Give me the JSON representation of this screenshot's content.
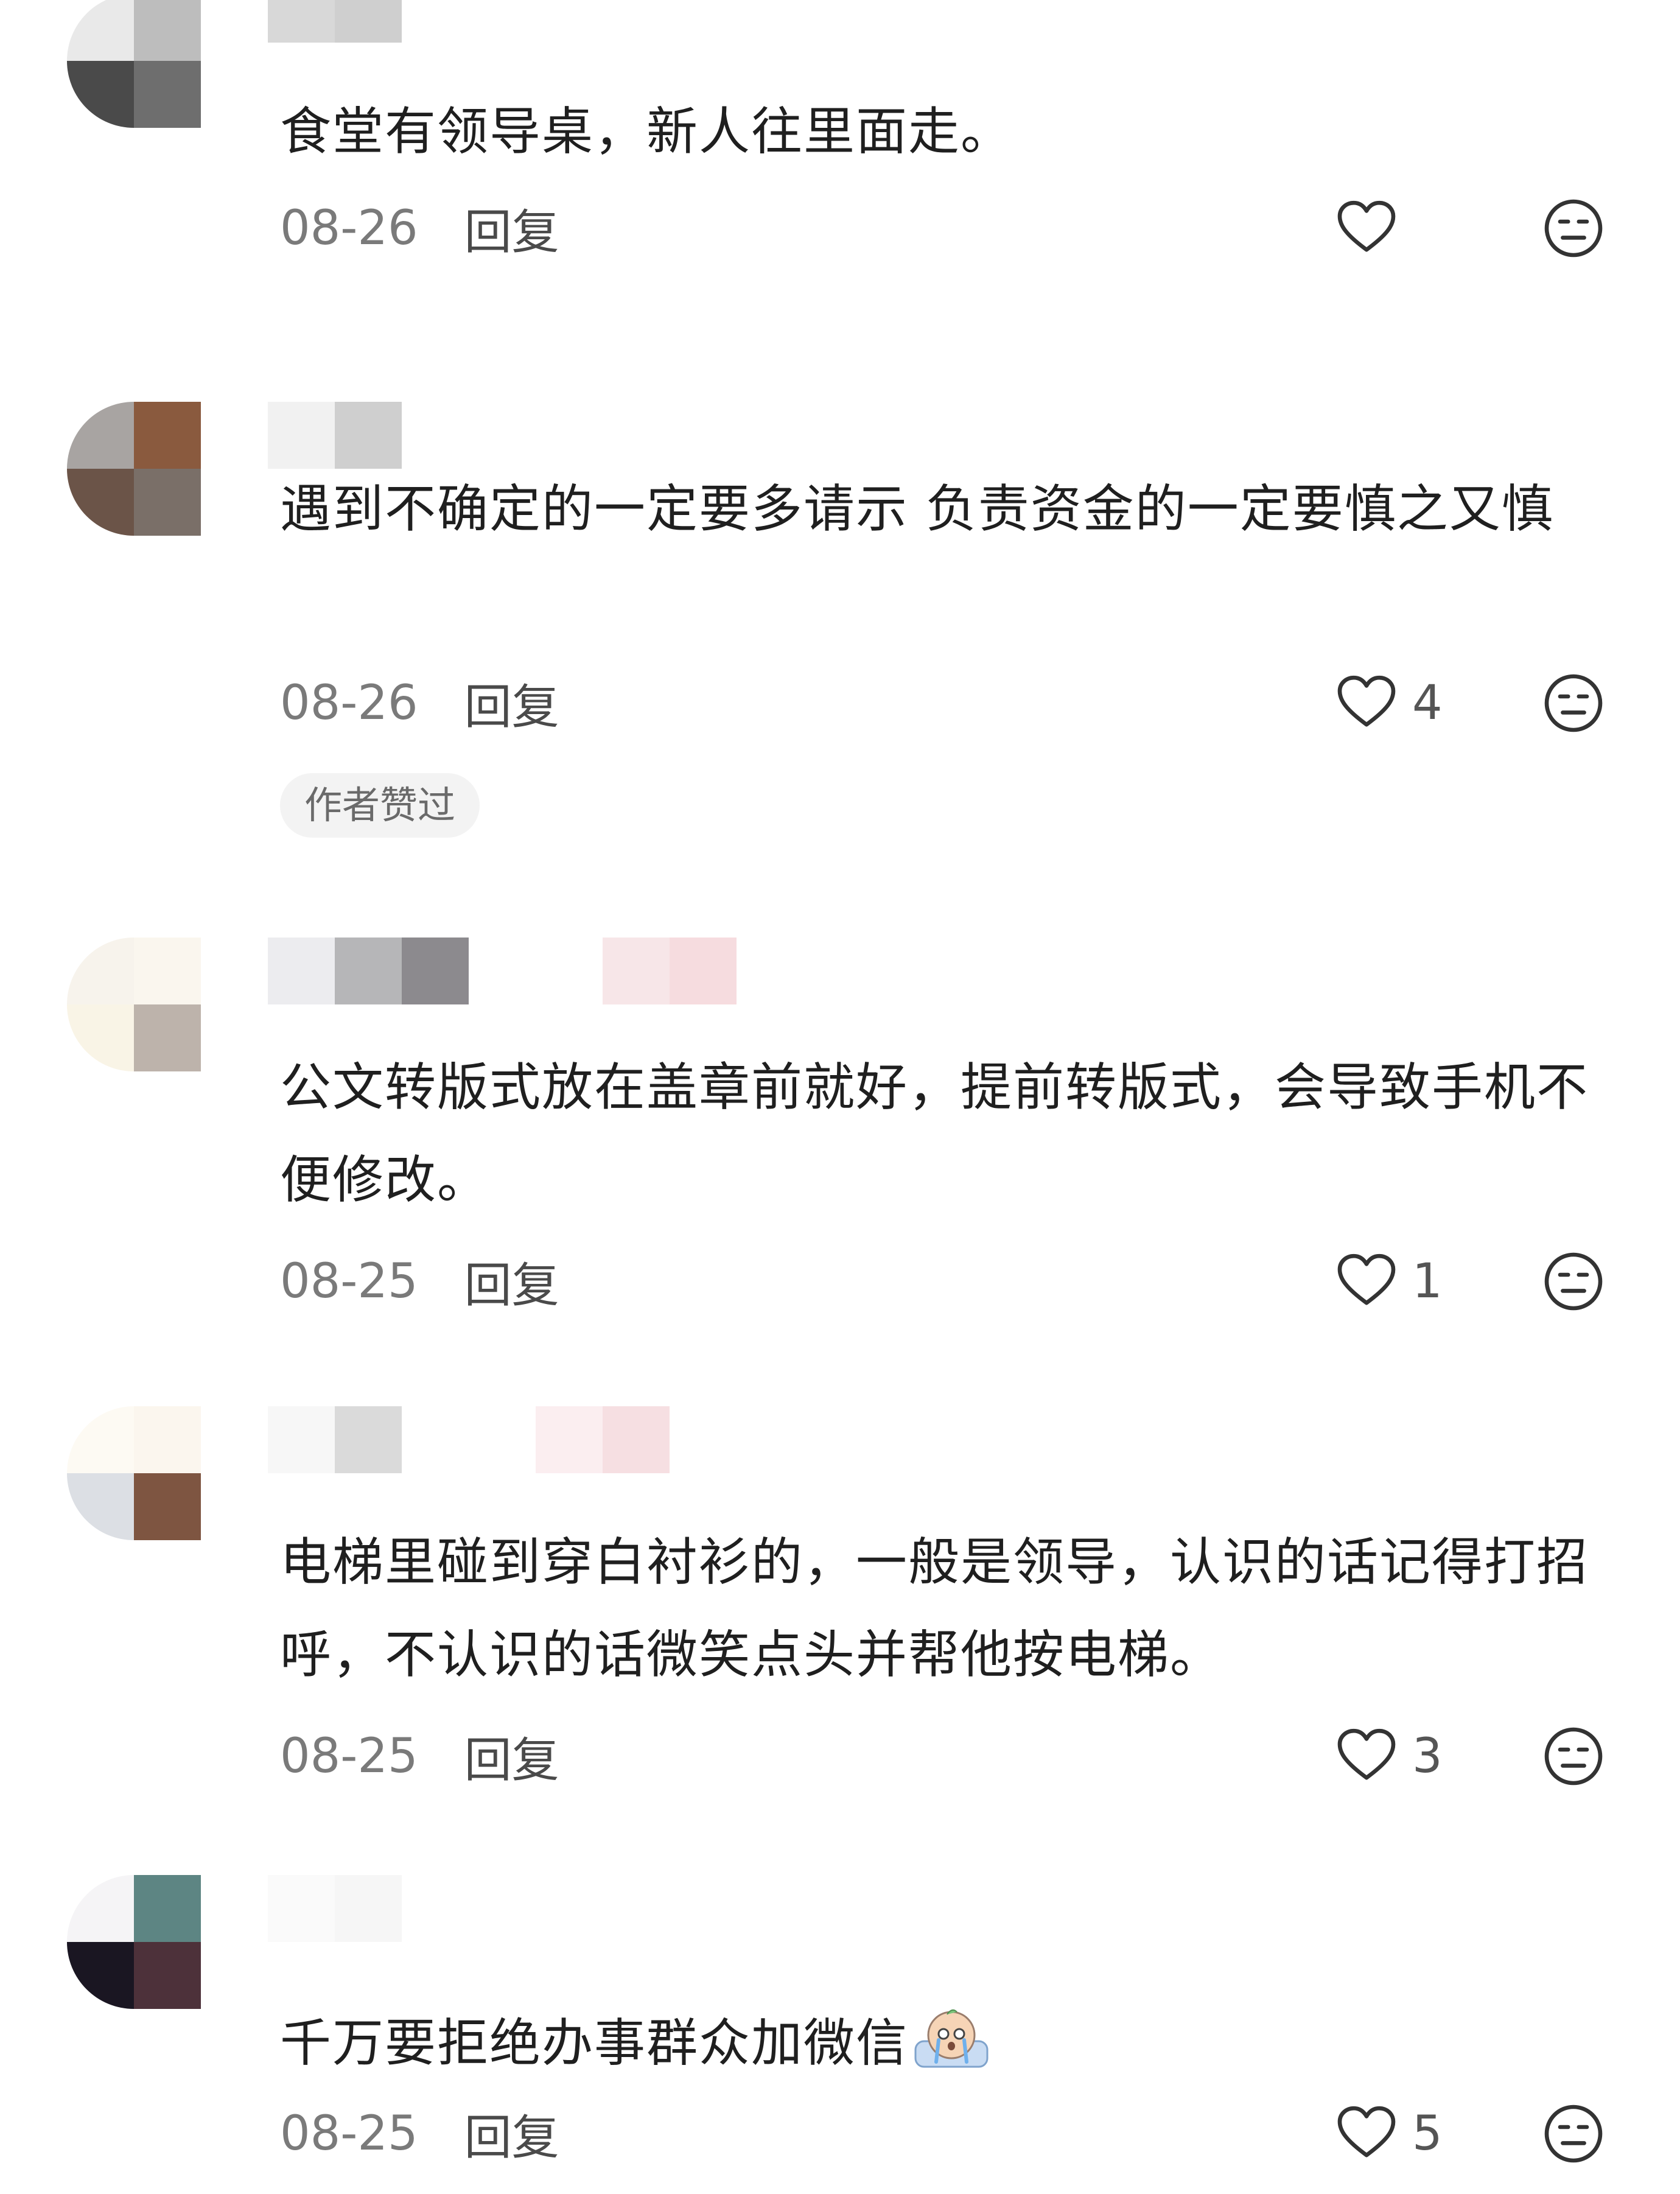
{
  "comments": [
    {
      "text": "食堂有领导桌，新人往里面走。",
      "date": "08-26",
      "reply": "回复",
      "likes": "",
      "avatar_colors": [
        "#3a3a3a",
        "#bdbdbd",
        "#5a5a5a",
        "#6e6e6e"
      ],
      "name_colors": [
        "#d8d8d8",
        "#c8c8c8"
      ]
    },
    {
      "text": "遇到不确定的一定要多请示 负责资金的一定要慎之又慎",
      "date": "08-26",
      "reply": "回复",
      "likes": "4",
      "badge": "作者赞过",
      "avatar_colors": [
        "#a8a4a2",
        "#8a5a3e",
        "#6b5448",
        "#7a6f68"
      ],
      "name_colors": [
        "#f1f1f1",
        "#cfcfcf"
      ]
    },
    {
      "text": "公文转版式放在盖章前就好，提前转版式，会导致手机不便修改。",
      "date": "08-25",
      "reply": "回复",
      "likes": "1",
      "avatar_colors": [
        "#f7f3ec",
        "#faf6ee",
        "#f9f4e6",
        "#bdb3ab"
      ],
      "name_colors": [
        "#ececef",
        "#b6b6b8",
        "#8c8a8e",
        "#f7e6e8",
        "#f6dcdf"
      ]
    },
    {
      "text": "电梯里碰到穿白衬衫的，一般是领导，认识的话记得打招呼，不认识的话微笑点头并帮他按电梯。",
      "date": "08-25",
      "reply": "回复",
      "likes": "3",
      "avatar_colors": [
        "#fdfaf3",
        "#fbf6ee",
        "#9ea4b0",
        "#7e5541"
      ],
      "name_colors": [
        "#f7f7f7",
        "#dadada",
        "#fbeef0",
        "#f6dfe2"
      ]
    },
    {
      "text": "千万要拒绝办事群众加微信",
      "date": "08-25",
      "reply": "回复",
      "likes": "5",
      "avatar_colors": [
        "#f5f4f6",
        "#5d8583",
        "#1a1622",
        "#4d313a"
      ],
      "name_colors": [
        "#fafafa",
        "#f6f6f6"
      ]
    }
  ],
  "icons": {
    "like": "heart-outline-icon",
    "dislike": "meh-face-icon",
    "emoji": "crying-emoji-icon"
  },
  "colors": {
    "text": "#1f1f1f",
    "meta": "#7a7a7a",
    "icon": "#333333"
  }
}
